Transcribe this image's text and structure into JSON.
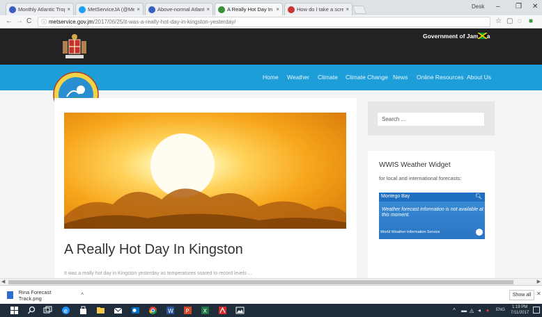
{
  "browser": {
    "tabs": [
      {
        "label": "Monthly Atlantic Tropica",
        "color": "#3b5fc0"
      },
      {
        "label": "MetServiceJA (@Meteor",
        "color": "#1da1f2"
      },
      {
        "label": "Above-normal Atlantic h",
        "color": "#3b5fc0"
      },
      {
        "label": "A Really Hot Day In Kings",
        "color": "#3a8f3a"
      },
      {
        "label": "How do I take a screensh",
        "color": "#cc3333"
      }
    ],
    "user_label": "Desk",
    "address": {
      "domain": "metservice.gov.jm",
      "path": "/2017/06/25/it-was-a-really-hot-day-in-kingston-yesterday/"
    }
  },
  "site": {
    "government_label": "Government of Jamaica",
    "menu": [
      "Home",
      "Weather",
      "Climate",
      "Climate Change",
      "News",
      "Online Resources",
      "About Us"
    ],
    "article": {
      "title": "A Really Hot Day In Kingston",
      "snippet": "It was a really hot day in Kingston yesterday as temperatures soared to record levels ..."
    },
    "search": {
      "placeholder": "Search ..."
    },
    "widget": {
      "title": "WWIS Weather Widget",
      "subtitle": "for local and international forecasts:",
      "city": "Montego Bay",
      "message": "Weather forecast information is not available at this moment.",
      "footer": "World Weather Information Service"
    }
  },
  "download_shelf": {
    "file": "Rina Forecast Track.png",
    "show_all": "Show all"
  },
  "taskbar": {
    "lang": "ENG",
    "time": "1:19 PM",
    "date": "7/11/2017"
  },
  "colors": {
    "navbar": "#1d9ed8",
    "topbar": "#222222",
    "taskbar": "#1f2c3a"
  }
}
